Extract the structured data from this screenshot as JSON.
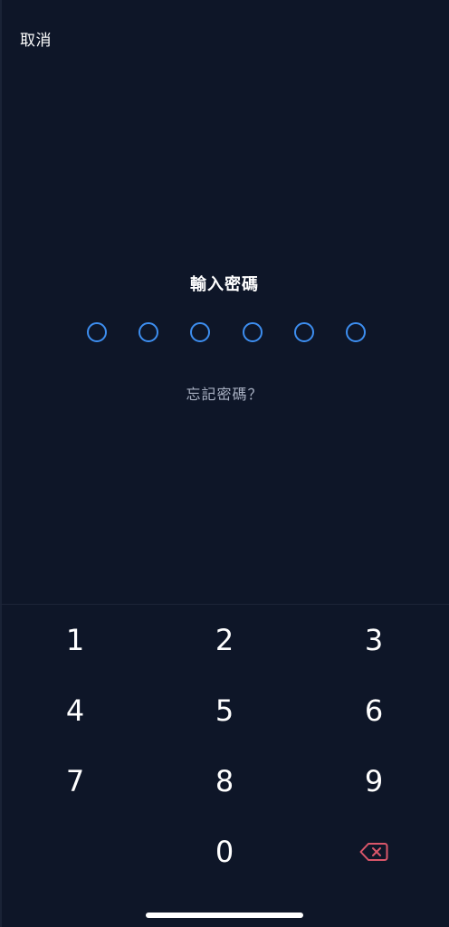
{
  "header": {
    "cancel_label": "取消"
  },
  "passcode": {
    "title": "輸入密碼",
    "digits_entered": 0,
    "digits_total": 6,
    "forgot_label": "忘記密碼？"
  },
  "keypad": {
    "keys": [
      "1",
      "2",
      "3",
      "4",
      "5",
      "6",
      "7",
      "8",
      "9",
      "",
      "0"
    ],
    "backspace_icon": "backspace-icon"
  },
  "colors": {
    "background": "#0e1628",
    "dot_outline": "#3d8ef0",
    "backspace": "#d9566a"
  }
}
